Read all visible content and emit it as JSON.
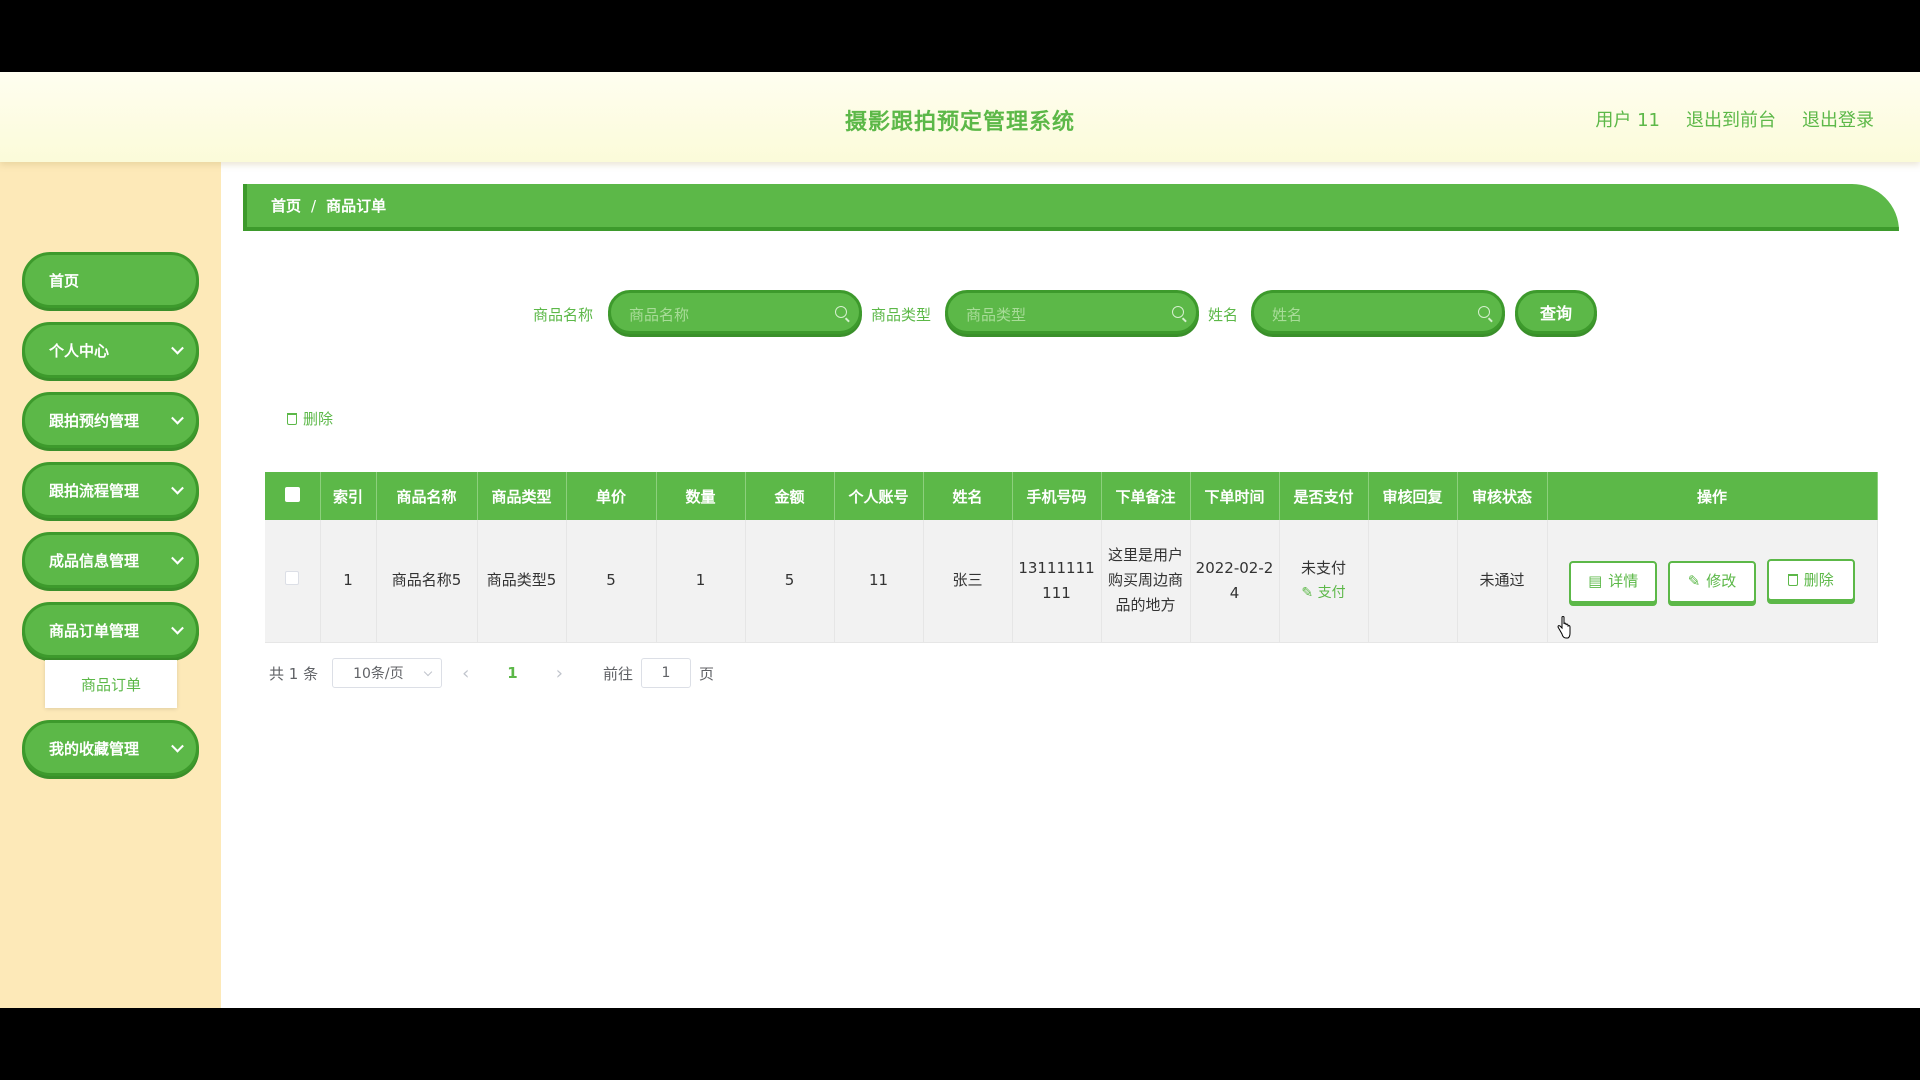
{
  "header": {
    "title": "摄影跟拍预定管理系统",
    "user": "用户 11",
    "frontend": "退出到前台",
    "logout": "退出登录"
  },
  "sidebar": {
    "items": [
      {
        "label": "首页"
      },
      {
        "label": "个人中心"
      },
      {
        "label": "跟拍预约管理"
      },
      {
        "label": "跟拍流程管理"
      },
      {
        "label": "成品信息管理"
      },
      {
        "label": "商品订单管理"
      },
      {
        "label": "我的收藏管理"
      }
    ],
    "sub_item": "商品订单"
  },
  "breadcrumb": {
    "home": "首页",
    "sep": "/",
    "current": "商品订单"
  },
  "search": {
    "product_name_label": "商品名称",
    "product_name_placeholder": "商品名称",
    "product_type_label": "商品类型",
    "product_type_placeholder": "商品类型",
    "name_label": "姓名",
    "name_placeholder": "姓名",
    "query": "查询"
  },
  "toolbar": {
    "delete": "删除"
  },
  "table": {
    "headers": [
      "索引",
      "商品名称",
      "商品类型",
      "单价",
      "数量",
      "金额",
      "个人账号",
      "姓名",
      "手机号码",
      "下单备注",
      "下单时间",
      "是否支付",
      "审核回复",
      "审核状态",
      "操作"
    ],
    "rows": [
      {
        "index": "1",
        "product_name": "商品名称5",
        "product_type": "商品类型5",
        "price": "5",
        "quantity": "1",
        "amount": "5",
        "account": "11",
        "name": "张三",
        "phone": "13111111111",
        "remark": "这里是用户购买周边商品的地方",
        "time": "2022-02-24",
        "paid": "未支付",
        "pay_link": "支付",
        "review_reply": "",
        "review_status": "未通过",
        "ops": {
          "detail": "详情",
          "edit": "修改",
          "delete": "删除"
        }
      }
    ]
  },
  "pagination": {
    "total": "共 1 条",
    "page_size": "10条/页",
    "current_page": "1",
    "goto": "前往",
    "goto_value": "1",
    "page_unit": "页"
  },
  "colors": {
    "primary": "#5cb848",
    "primary_dark": "#3d9a2c",
    "sidebar_bg": "#fde9b8",
    "header_bg": "#fbfbd9"
  }
}
